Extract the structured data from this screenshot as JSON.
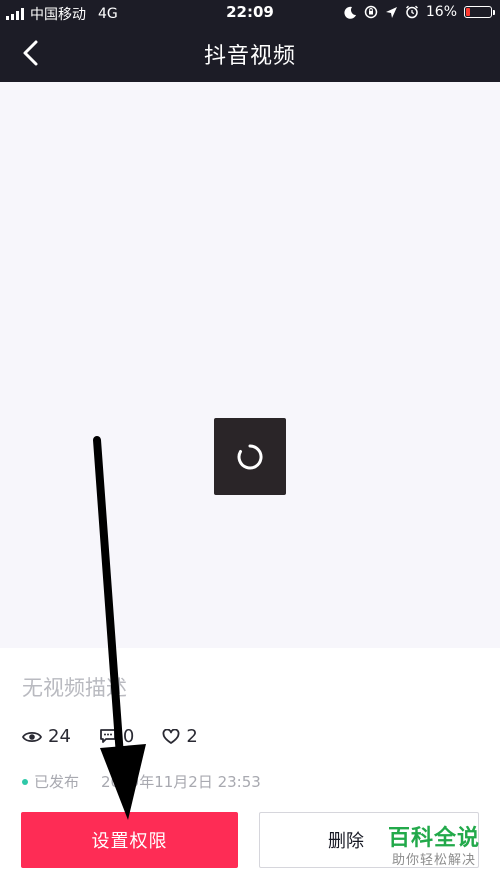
{
  "status_bar": {
    "carrier": "中国移动",
    "network": "4G",
    "time": "22:09",
    "battery": "16%",
    "battery_level": 0.16
  },
  "navbar": {
    "title": "抖音视频",
    "back_icon": "chevron-left-icon"
  },
  "video": {
    "spinner_icon": "loading-spinner-icon"
  },
  "info": {
    "description": "无视频描述",
    "stats": {
      "views": "24",
      "comments": "0",
      "likes": "2"
    },
    "status_label": "已发布",
    "publish_date": "2019年11月2日 23:53",
    "status_color": "#2ec8a8"
  },
  "actions": {
    "permission_label": "设置权限",
    "delete_label": "删除"
  },
  "watermark": {
    "main": "百科全说",
    "sub": "助你轻松解决"
  },
  "colors": {
    "accent": "#fe2c55",
    "header_bg": "#1c1c26",
    "watermark_green": "#22a94a"
  }
}
